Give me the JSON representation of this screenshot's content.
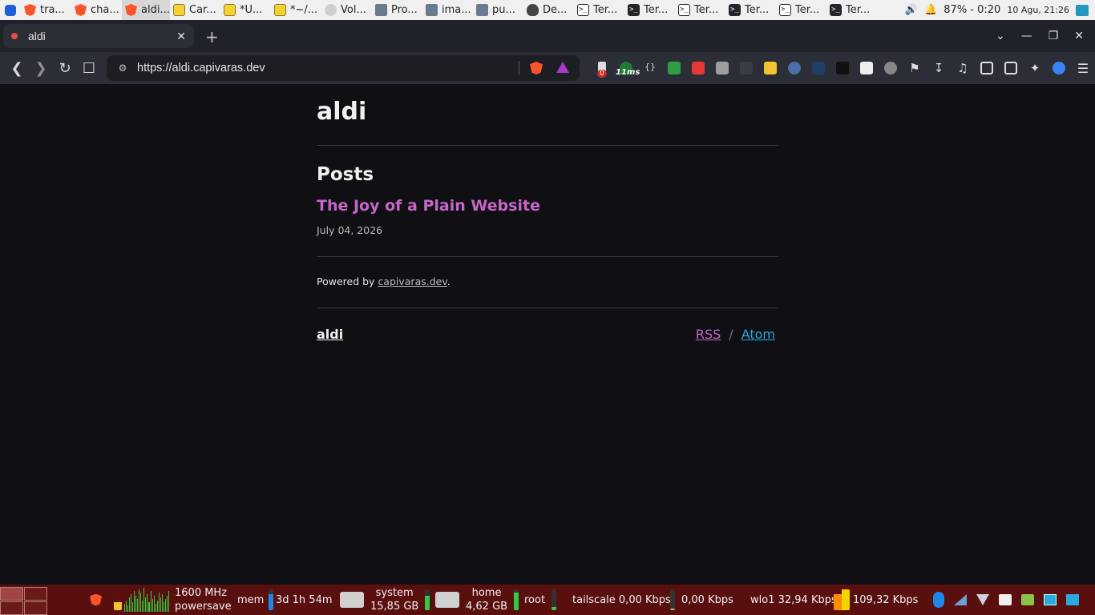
{
  "top_panel": {
    "tasks": [
      {
        "icon": "brave-icon",
        "label": "tra...",
        "active": false
      },
      {
        "icon": "brave-icon",
        "label": "cha...",
        "active": false
      },
      {
        "icon": "brave-icon",
        "label": "aldi...",
        "active": true
      },
      {
        "icon": "note-icon",
        "label": "Car...",
        "active": false
      },
      {
        "icon": "note-icon",
        "label": "*U...",
        "active": false
      },
      {
        "icon": "note-icon",
        "label": "*~/...",
        "active": false
      },
      {
        "icon": "volume-app-icon",
        "label": "Vol...",
        "active": false
      },
      {
        "icon": "folder-icon",
        "label": "Pro...",
        "active": false
      },
      {
        "icon": "folder-icon",
        "label": "ima...",
        "active": false
      },
      {
        "icon": "folder-icon",
        "label": "pu...",
        "active": false
      },
      {
        "icon": "app-icon",
        "label": "De...",
        "active": false
      },
      {
        "icon": "terminal-icon",
        "label": "Ter...",
        "active": false
      },
      {
        "icon": "terminal-icon",
        "label": "Ter...",
        "active": false
      },
      {
        "icon": "terminal-icon",
        "label": "Ter...",
        "active": false
      },
      {
        "icon": "terminal-icon",
        "label": "Ter...",
        "active": false
      },
      {
        "icon": "terminal-icon",
        "label": "Ter...",
        "active": false
      },
      {
        "icon": "terminal-icon",
        "label": "Ter...",
        "active": false
      }
    ],
    "battery": "87% - 0:20",
    "clock": "10 Agu, 21:26"
  },
  "browser": {
    "tab_title": "aldi",
    "url": "https://aldi.capivaras.dev",
    "extension_badge": "0",
    "extension_ms": "11ms"
  },
  "page": {
    "site_title": "aldi",
    "posts_heading": "Posts",
    "post_title": "The Joy of a Plain Website",
    "post_date": "July 04, 2026",
    "powered_prefix": "Powered by",
    "powered_link": "capivaras.dev",
    "powered_suffix": ".",
    "footer_name": "aldi",
    "rss": "RSS",
    "separator": "/",
    "atom": "Atom"
  },
  "bottom_panel": {
    "cpu_freq": "1600 MHz",
    "cpu_governor": "powersave",
    "mem_label": "mem",
    "uptime": "3d 1h 54m",
    "system_label": "system",
    "system_size": "15,85 GB",
    "home_label": "home",
    "home_size": "4,62 GB",
    "root_label": "root",
    "tailscale": "tailscale 0,00 Kbps",
    "net2": "0,00 Kbps",
    "wlo1": "wlo1 32,94 Kbps",
    "net3": "109,32 Kbps"
  },
  "colors": {
    "post_link": "#c566c9",
    "atom_link": "#2aa8e0",
    "bottom_panel_bg": "#5a0f0f"
  }
}
